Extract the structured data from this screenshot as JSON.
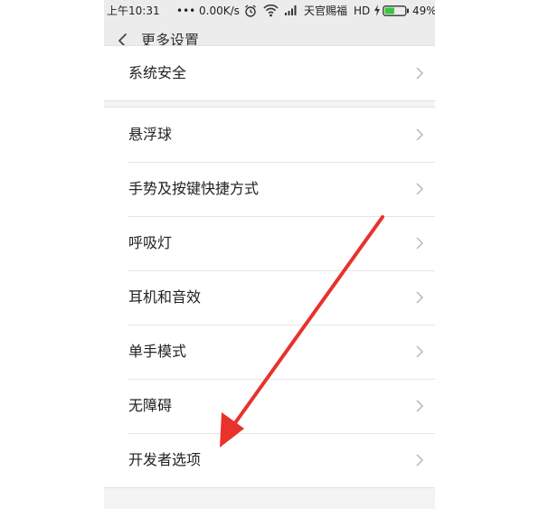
{
  "status_bar": {
    "time": "上午10:31",
    "speed": "••• 0.00K/s",
    "carrier": "天官赐福",
    "network": "HD",
    "battery": "49%"
  },
  "header": {
    "title": "更多设置"
  },
  "top_group": {
    "items": [
      {
        "label": "系统安全"
      }
    ]
  },
  "main_group": {
    "items": [
      {
        "label": "悬浮球"
      },
      {
        "label": "手势及按键快捷方式"
      },
      {
        "label": "呼吸灯"
      },
      {
        "label": "耳机和音效"
      },
      {
        "label": "单手模式"
      },
      {
        "label": "无障碍"
      },
      {
        "label": "开发者选项"
      }
    ]
  },
  "colors": {
    "annotation_arrow": "#e8322c",
    "battery_fill": "#3cc43c"
  },
  "icons": [
    "back-icon",
    "alarm-icon",
    "wifi-icon",
    "signal-icon",
    "charging-icon",
    "battery-icon",
    "chevron-right-icon",
    "red-annotation-arrow"
  ]
}
